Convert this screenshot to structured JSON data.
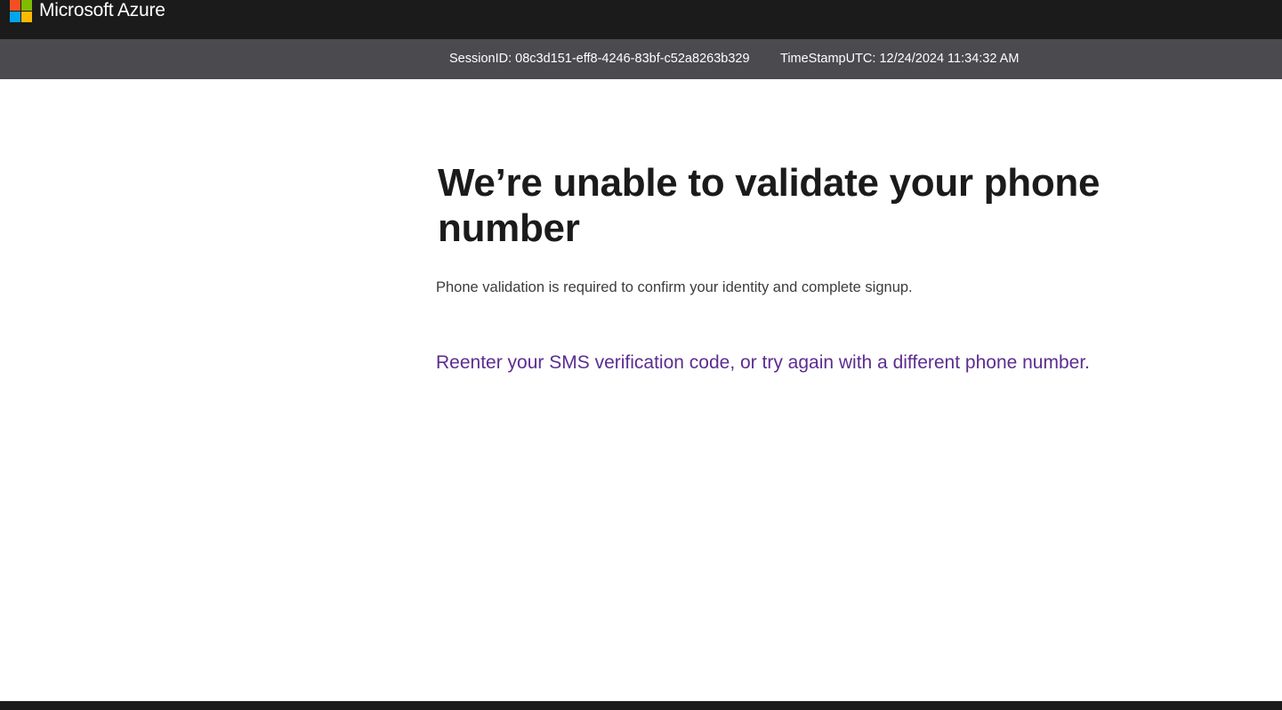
{
  "header": {
    "brand": "Microsoft Azure",
    "logo_icon": "microsoft-logo-icon",
    "colors": {
      "bar": "#1b1b1b",
      "logo": [
        "#f25022",
        "#7fba00",
        "#00a4ef",
        "#ffb900"
      ]
    }
  },
  "info_bar": {
    "session": "SessionID: 08c3d151-eff8-4246-83bf-c52a8263b329",
    "timestamp": "TimeStampUTC: 12/24/2024 11:34:32 AM",
    "background": "#4a4a4f"
  },
  "main": {
    "title": "We’re unable to validate your phone number",
    "description": "Phone validation is required to confirm your identity and complete signup.",
    "retry_link": "Reenter your SMS verification code, or try again with a different phone number.",
    "link_color": "#5c2d91"
  }
}
